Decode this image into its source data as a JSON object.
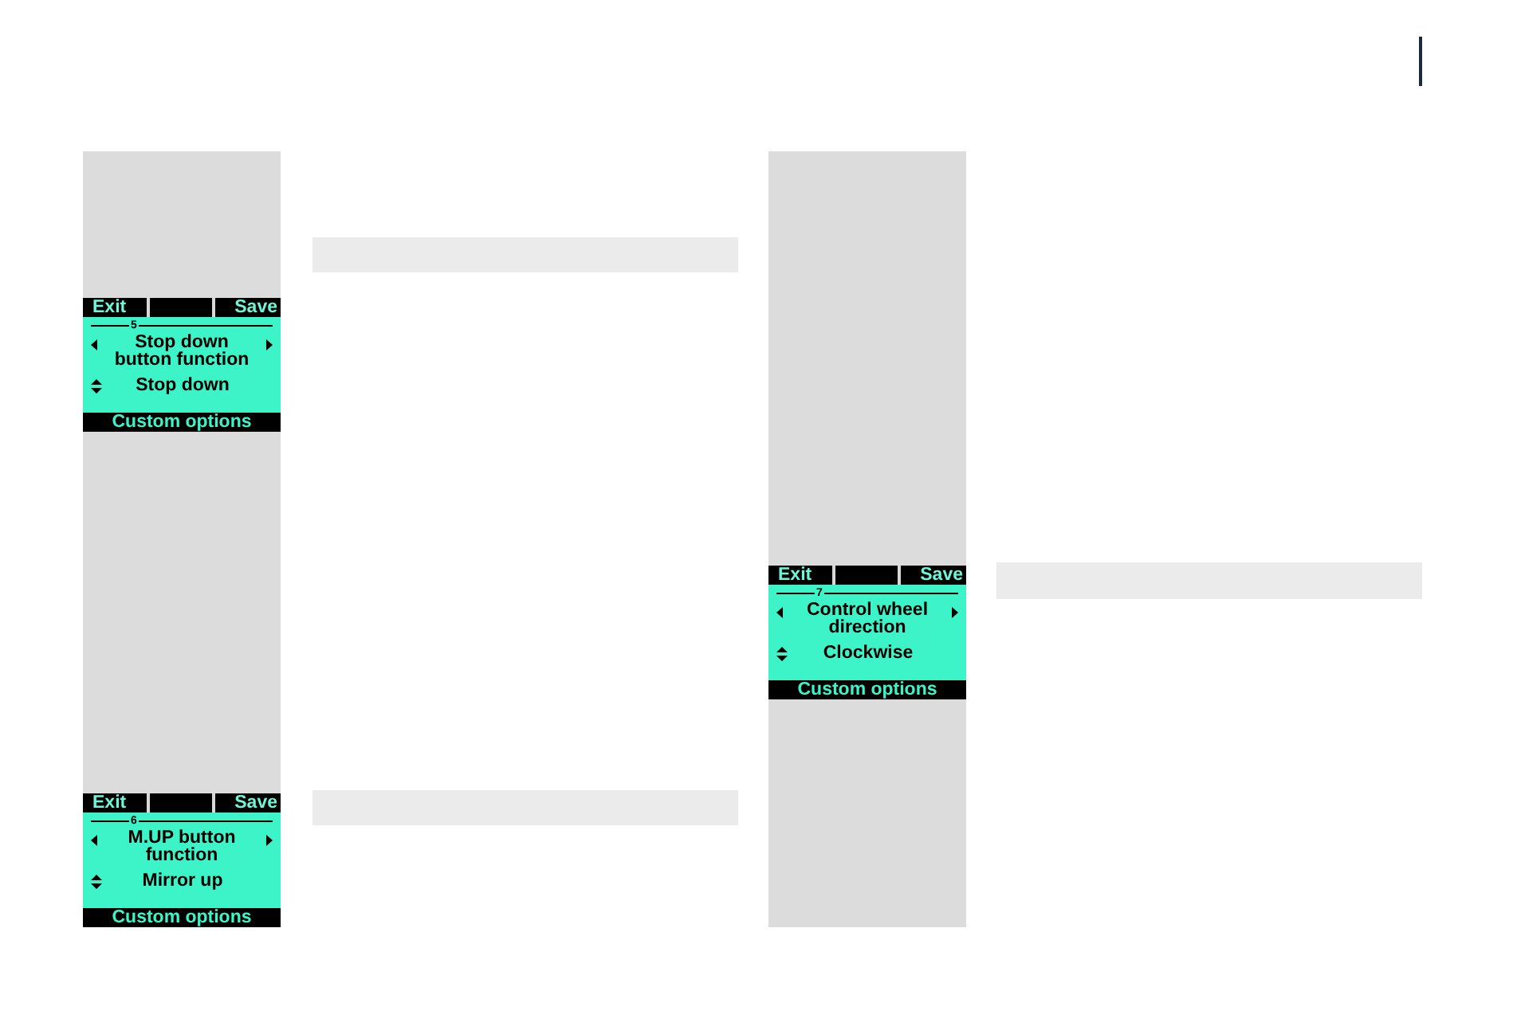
{
  "left_sidebar": {
    "screens": [
      {
        "left_softkey": "Exit",
        "right_softkey": "Save",
        "number": "5",
        "title_lines": [
          "Stop down",
          "button function"
        ],
        "value": "Stop down",
        "footer": "Custom options"
      },
      {
        "left_softkey": "Exit",
        "right_softkey": "Save",
        "number": "6",
        "title_lines": [
          "M.UP button",
          "function"
        ],
        "value": "Mirror up",
        "footer": "Custom options"
      }
    ]
  },
  "right_sidebar": {
    "screens": [
      {
        "left_softkey": "Exit",
        "right_softkey": "Save",
        "number": "7",
        "title_lines": [
          "Control wheel",
          "direction"
        ],
        "value": "Clockwise",
        "footer": "Custom options"
      }
    ]
  }
}
